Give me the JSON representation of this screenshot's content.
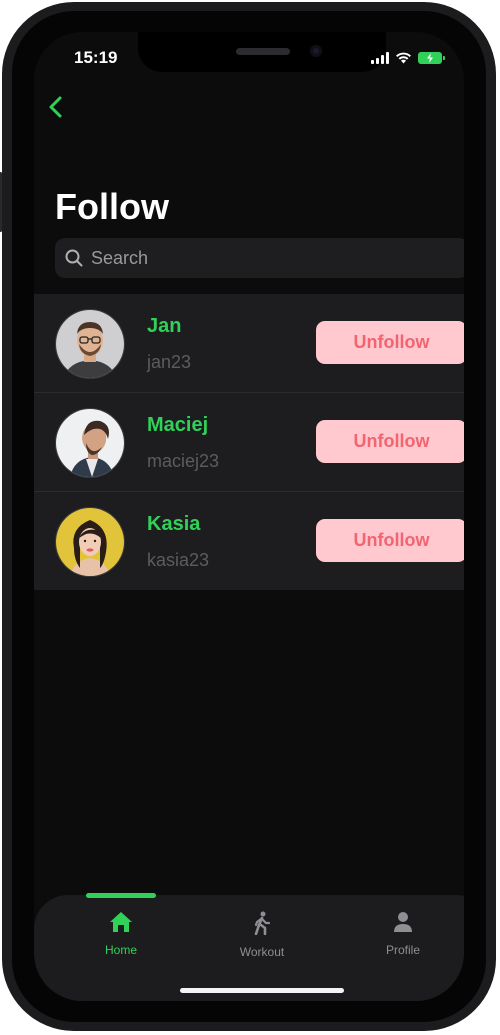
{
  "status_bar": {
    "time": "15:19"
  },
  "header": {
    "title": "Follow"
  },
  "search": {
    "placeholder": "Search"
  },
  "users": [
    {
      "name": "Jan",
      "handle": "jan23",
      "action": "Unfollow"
    },
    {
      "name": "Maciej",
      "handle": "maciej23",
      "action": "Unfollow"
    },
    {
      "name": "Kasia",
      "handle": "kasia23",
      "action": "Unfollow"
    }
  ],
  "tabbar": {
    "items": [
      {
        "label": "Home",
        "icon": "home-icon",
        "active": true
      },
      {
        "label": "Workout",
        "icon": "walking-icon",
        "active": false
      },
      {
        "label": "Profile",
        "icon": "person-icon",
        "active": false
      }
    ]
  },
  "colors": {
    "accent": "#30d158",
    "unfollow_bg": "#ffc9cf",
    "unfollow_text": "#f26470",
    "background": "#0c0c0d"
  }
}
